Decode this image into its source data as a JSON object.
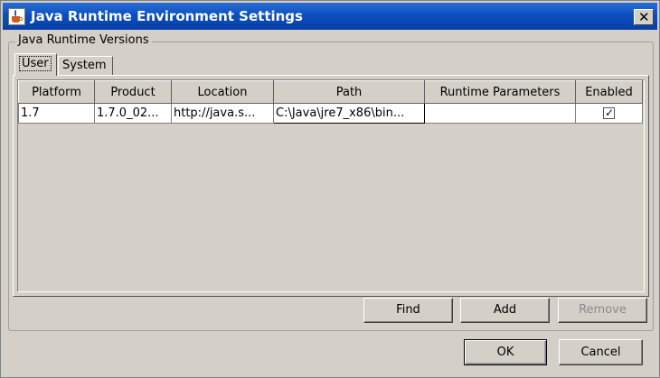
{
  "window": {
    "title": "Java Runtime Environment Settings",
    "close_glyph": "✕",
    "app_icon": "java-cup-icon"
  },
  "group": {
    "label": "Java Runtime Versions"
  },
  "tabs": [
    {
      "label": "User",
      "selected": true
    },
    {
      "label": "System",
      "selected": false
    }
  ],
  "table": {
    "columns": [
      "Platform",
      "Product",
      "Location",
      "Path",
      "Runtime Parameters",
      "Enabled"
    ],
    "rows": [
      {
        "platform": "1.7",
        "product": "1.7.0_02...",
        "location": "http://java.s...",
        "path": "C:\\Java\\jre7_x86\\bin...",
        "runtime_parameters": "",
        "enabled": true,
        "enabled_glyph": "✓"
      }
    ]
  },
  "buttons": {
    "find": "Find",
    "add": "Add",
    "remove": "Remove",
    "ok": "OK",
    "cancel": "Cancel"
  },
  "colors": {
    "titlebar": "#0a4fbf",
    "window_bg": "#d4d0c8",
    "disabled_text": "#8a8a8a"
  }
}
